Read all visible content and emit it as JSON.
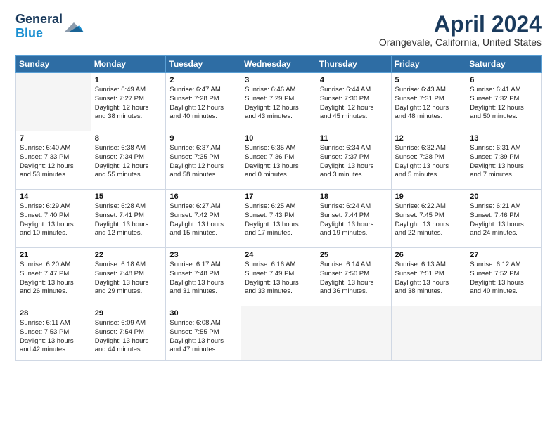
{
  "header": {
    "logo_general": "General",
    "logo_blue": "Blue",
    "title": "April 2024",
    "location": "Orangevale, California, United States"
  },
  "weekdays": [
    "Sunday",
    "Monday",
    "Tuesday",
    "Wednesday",
    "Thursday",
    "Friday",
    "Saturday"
  ],
  "weeks": [
    [
      {
        "day": "",
        "lines": []
      },
      {
        "day": "1",
        "lines": [
          "Sunrise: 6:49 AM",
          "Sunset: 7:27 PM",
          "Daylight: 12 hours",
          "and 38 minutes."
        ]
      },
      {
        "day": "2",
        "lines": [
          "Sunrise: 6:47 AM",
          "Sunset: 7:28 PM",
          "Daylight: 12 hours",
          "and 40 minutes."
        ]
      },
      {
        "day": "3",
        "lines": [
          "Sunrise: 6:46 AM",
          "Sunset: 7:29 PM",
          "Daylight: 12 hours",
          "and 43 minutes."
        ]
      },
      {
        "day": "4",
        "lines": [
          "Sunrise: 6:44 AM",
          "Sunset: 7:30 PM",
          "Daylight: 12 hours",
          "and 45 minutes."
        ]
      },
      {
        "day": "5",
        "lines": [
          "Sunrise: 6:43 AM",
          "Sunset: 7:31 PM",
          "Daylight: 12 hours",
          "and 48 minutes."
        ]
      },
      {
        "day": "6",
        "lines": [
          "Sunrise: 6:41 AM",
          "Sunset: 7:32 PM",
          "Daylight: 12 hours",
          "and 50 minutes."
        ]
      }
    ],
    [
      {
        "day": "7",
        "lines": [
          "Sunrise: 6:40 AM",
          "Sunset: 7:33 PM",
          "Daylight: 12 hours",
          "and 53 minutes."
        ]
      },
      {
        "day": "8",
        "lines": [
          "Sunrise: 6:38 AM",
          "Sunset: 7:34 PM",
          "Daylight: 12 hours",
          "and 55 minutes."
        ]
      },
      {
        "day": "9",
        "lines": [
          "Sunrise: 6:37 AM",
          "Sunset: 7:35 PM",
          "Daylight: 12 hours",
          "and 58 minutes."
        ]
      },
      {
        "day": "10",
        "lines": [
          "Sunrise: 6:35 AM",
          "Sunset: 7:36 PM",
          "Daylight: 13 hours",
          "and 0 minutes."
        ]
      },
      {
        "day": "11",
        "lines": [
          "Sunrise: 6:34 AM",
          "Sunset: 7:37 PM",
          "Daylight: 13 hours",
          "and 3 minutes."
        ]
      },
      {
        "day": "12",
        "lines": [
          "Sunrise: 6:32 AM",
          "Sunset: 7:38 PM",
          "Daylight: 13 hours",
          "and 5 minutes."
        ]
      },
      {
        "day": "13",
        "lines": [
          "Sunrise: 6:31 AM",
          "Sunset: 7:39 PM",
          "Daylight: 13 hours",
          "and 7 minutes."
        ]
      }
    ],
    [
      {
        "day": "14",
        "lines": [
          "Sunrise: 6:29 AM",
          "Sunset: 7:40 PM",
          "Daylight: 13 hours",
          "and 10 minutes."
        ]
      },
      {
        "day": "15",
        "lines": [
          "Sunrise: 6:28 AM",
          "Sunset: 7:41 PM",
          "Daylight: 13 hours",
          "and 12 minutes."
        ]
      },
      {
        "day": "16",
        "lines": [
          "Sunrise: 6:27 AM",
          "Sunset: 7:42 PM",
          "Daylight: 13 hours",
          "and 15 minutes."
        ]
      },
      {
        "day": "17",
        "lines": [
          "Sunrise: 6:25 AM",
          "Sunset: 7:43 PM",
          "Daylight: 13 hours",
          "and 17 minutes."
        ]
      },
      {
        "day": "18",
        "lines": [
          "Sunrise: 6:24 AM",
          "Sunset: 7:44 PM",
          "Daylight: 13 hours",
          "and 19 minutes."
        ]
      },
      {
        "day": "19",
        "lines": [
          "Sunrise: 6:22 AM",
          "Sunset: 7:45 PM",
          "Daylight: 13 hours",
          "and 22 minutes."
        ]
      },
      {
        "day": "20",
        "lines": [
          "Sunrise: 6:21 AM",
          "Sunset: 7:46 PM",
          "Daylight: 13 hours",
          "and 24 minutes."
        ]
      }
    ],
    [
      {
        "day": "21",
        "lines": [
          "Sunrise: 6:20 AM",
          "Sunset: 7:47 PM",
          "Daylight: 13 hours",
          "and 26 minutes."
        ]
      },
      {
        "day": "22",
        "lines": [
          "Sunrise: 6:18 AM",
          "Sunset: 7:48 PM",
          "Daylight: 13 hours",
          "and 29 minutes."
        ]
      },
      {
        "day": "23",
        "lines": [
          "Sunrise: 6:17 AM",
          "Sunset: 7:48 PM",
          "Daylight: 13 hours",
          "and 31 minutes."
        ]
      },
      {
        "day": "24",
        "lines": [
          "Sunrise: 6:16 AM",
          "Sunset: 7:49 PM",
          "Daylight: 13 hours",
          "and 33 minutes."
        ]
      },
      {
        "day": "25",
        "lines": [
          "Sunrise: 6:14 AM",
          "Sunset: 7:50 PM",
          "Daylight: 13 hours",
          "and 36 minutes."
        ]
      },
      {
        "day": "26",
        "lines": [
          "Sunrise: 6:13 AM",
          "Sunset: 7:51 PM",
          "Daylight: 13 hours",
          "and 38 minutes."
        ]
      },
      {
        "day": "27",
        "lines": [
          "Sunrise: 6:12 AM",
          "Sunset: 7:52 PM",
          "Daylight: 13 hours",
          "and 40 minutes."
        ]
      }
    ],
    [
      {
        "day": "28",
        "lines": [
          "Sunrise: 6:11 AM",
          "Sunset: 7:53 PM",
          "Daylight: 13 hours",
          "and 42 minutes."
        ]
      },
      {
        "day": "29",
        "lines": [
          "Sunrise: 6:09 AM",
          "Sunset: 7:54 PM",
          "Daylight: 13 hours",
          "and 44 minutes."
        ]
      },
      {
        "day": "30",
        "lines": [
          "Sunrise: 6:08 AM",
          "Sunset: 7:55 PM",
          "Daylight: 13 hours",
          "and 47 minutes."
        ]
      },
      {
        "day": "",
        "lines": []
      },
      {
        "day": "",
        "lines": []
      },
      {
        "day": "",
        "lines": []
      },
      {
        "day": "",
        "lines": []
      }
    ]
  ]
}
